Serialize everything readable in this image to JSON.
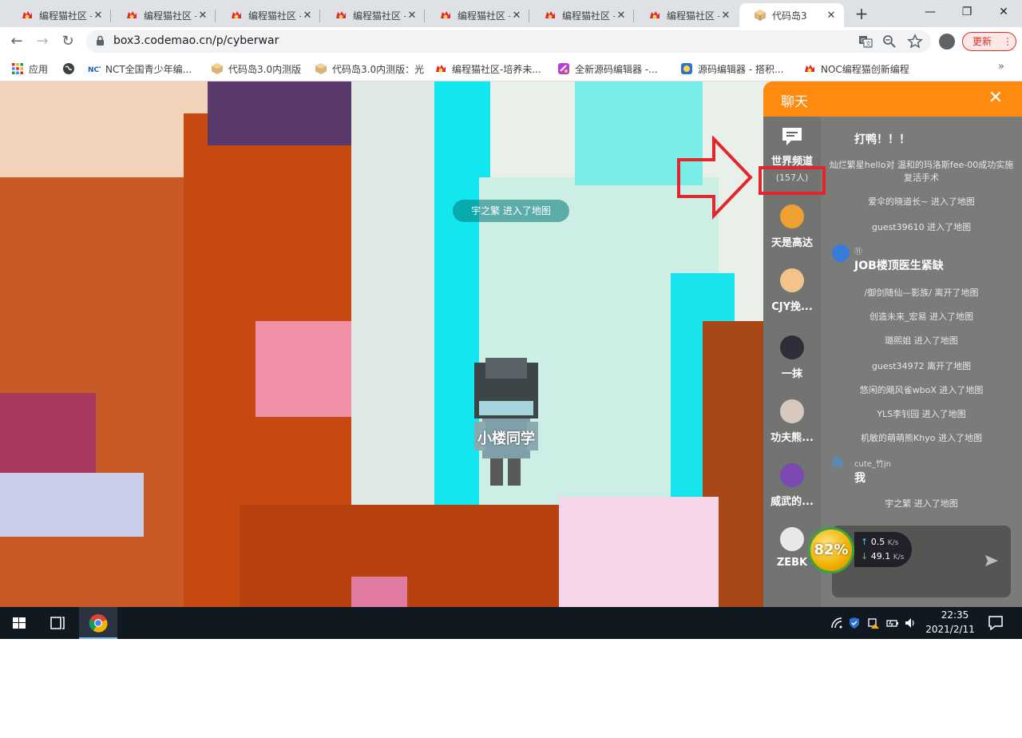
{
  "browser": {
    "tabs": [
      {
        "title": "编程猫社区 - ",
        "active": false
      },
      {
        "title": "编程猫社区 - ",
        "active": false
      },
      {
        "title": "编程猫社区 - ",
        "active": false
      },
      {
        "title": "编程猫社区 - ",
        "active": false
      },
      {
        "title": "编程猫社区 - ",
        "active": false
      },
      {
        "title": "编程猫社区 - ",
        "active": false
      },
      {
        "title": "编程猫社区 - ",
        "active": false
      },
      {
        "title": "代码岛3",
        "active": true
      }
    ],
    "tab_close": "✕",
    "new_tab": "+",
    "window_controls": {
      "minimize": "—",
      "restore": "❐",
      "close": "✕"
    },
    "nav": {
      "back": "←",
      "forward": "→",
      "reload": "↻"
    },
    "url": "box3.codemao.cn/p/cyberwar",
    "omnibox_icons": [
      "translate-icon",
      "zoom-icon",
      "star-icon"
    ],
    "update_label": "更新",
    "update_more": "⋮",
    "bookmarks": [
      {
        "label": "应用",
        "icon": "apps-icon"
      },
      {
        "label": "",
        "icon": "globe-icon"
      },
      {
        "label": "NCT全国青少年编...",
        "icon": "nct-icon"
      },
      {
        "label": "代码岛3.0内测版",
        "icon": "box-icon"
      },
      {
        "label": "代码岛3.0内测版：光",
        "icon": "box-icon"
      },
      {
        "label": "编程猫社区-培养未...",
        "icon": "codemao-icon"
      },
      {
        "label": "全新源码编辑器 -...",
        "icon": "editor-icon"
      },
      {
        "label": "源码编辑器 - 搭积...",
        "icon": "blocks-icon"
      },
      {
        "label": "NOC编程猫创新编程",
        "icon": "codemao-icon"
      }
    ],
    "bookmarks_more": "»"
  },
  "game": {
    "enter_toast": "宇之繁 进入了地图",
    "player_name": "小楼同学"
  },
  "chat": {
    "title": "聊天",
    "close": "✕",
    "channels": [
      {
        "name": "世界频道",
        "count": "(157人)"
      },
      {
        "name": "天是高达",
        "count": ""
      },
      {
        "name": "CJY挽...",
        "count": ""
      },
      {
        "name": "一抹",
        "count": ""
      },
      {
        "name": "功夫熊...",
        "count": ""
      },
      {
        "name": "威武的...",
        "count": ""
      },
      {
        "name": "ZEBK",
        "count": ""
      }
    ],
    "messages": {
      "top_text": "打鸭！！！",
      "sys1": "灿烂繁星hello对 温和的玛洛斯fee-00成功实施复活手术",
      "sys2": "爱伞的晓道长~ 进入了地图",
      "sys3": "guest39610 进入了地图",
      "user1_name": "⑪",
      "user1_text": "JOB楼顶医生紧缺",
      "sys4": "/御剑随仙—影族/ 离开了地图",
      "sys5": "创造未来_宏易 进入了地图",
      "sys6": "璐熙姐 进入了地图",
      "sys7": "guest34972 离开了地图",
      "sys8": "悠闲的飓风雀wboX 进入了地图",
      "sys9": "YLS李钊园 进入了地图",
      "sys10": "机敏的萌萌熊Khyo 进入了地图",
      "user2_name": "cute_竹jn",
      "user2_text": "我",
      "sys11": "宇之繁 进入了地图"
    }
  },
  "network": {
    "percent": "82%",
    "up_value": "0.5",
    "down_value": "49.1",
    "unit": "K/s",
    "up_arrow": "↑",
    "down_arrow": "↓"
  },
  "taskbar": {
    "time": "22:35",
    "date": "2021/2/11"
  },
  "colors": {
    "chat_header": "#ff8a10",
    "annotation": "#e3262c",
    "update": "#d93025"
  }
}
